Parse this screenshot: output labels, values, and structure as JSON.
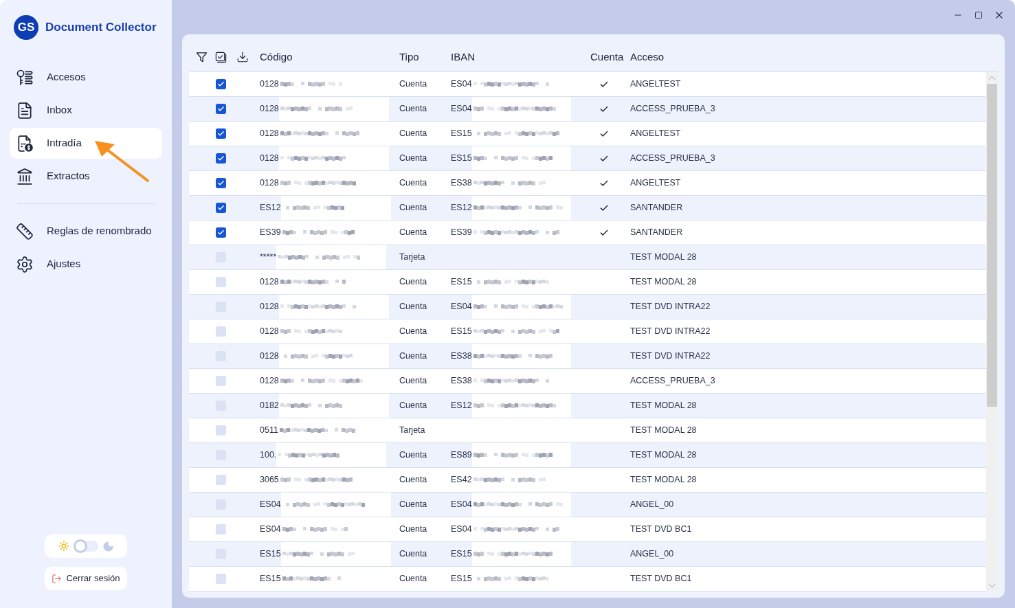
{
  "app": {
    "logo": "GS",
    "title": "Document Collector"
  },
  "nav_sections": [
    {
      "items": [
        {
          "label": "Accesos",
          "selected": false
        },
        {
          "label": "Inbox",
          "selected": false
        },
        {
          "label": "Intradía",
          "selected": true
        },
        {
          "label": "Extractos",
          "selected": false
        }
      ]
    },
    {
      "items": [
        {
          "label": "Reglas de renombrado",
          "selected": false
        },
        {
          "label": "Ajustes",
          "selected": false
        }
      ]
    }
  ],
  "theme_toggle": {
    "on": false
  },
  "logout_button": {
    "label": "Cerrar sesión"
  },
  "table": {
    "columns": [
      "Código",
      "Tipo",
      "IBAN",
      "Cuenta",
      "Acceso"
    ],
    "rows": [
      {
        "checked": true,
        "code": "0128",
        "type": "Cuenta",
        "iban": "ES04",
        "cuenta": true,
        "access": "ANGELTEST"
      },
      {
        "checked": true,
        "code": "0128",
        "type": "Cuenta",
        "iban": "ES04",
        "cuenta": true,
        "access": "ACCESS_PRUEBA_3"
      },
      {
        "checked": true,
        "code": "0128",
        "type": "Cuenta",
        "iban": "ES15",
        "cuenta": true,
        "access": "ANGELTEST"
      },
      {
        "checked": true,
        "code": "0128",
        "type": "Cuenta",
        "iban": "ES15",
        "cuenta": true,
        "access": "ACCESS_PRUEBA_3"
      },
      {
        "checked": true,
        "code": "0128",
        "type": "Cuenta",
        "iban": "ES38",
        "cuenta": true,
        "access": "ANGELTEST"
      },
      {
        "checked": true,
        "code": "ES12",
        "type": "Cuenta",
        "iban": "ES12",
        "cuenta": true,
        "access": "SANTANDER"
      },
      {
        "checked": true,
        "code": "ES39",
        "type": "Cuenta",
        "iban": "ES39",
        "cuenta": true,
        "access": "SANTANDER"
      },
      {
        "checked": false,
        "code": "*****",
        "type": "Tarjeta",
        "cuenta": false,
        "access": "TEST MODAL 28"
      },
      {
        "checked": false,
        "code": "0128",
        "type": "Cuenta",
        "iban": "ES15",
        "cuenta": false,
        "access": "TEST MODAL 28"
      },
      {
        "checked": false,
        "code": "0128",
        "type": "Cuenta",
        "iban": "ES04",
        "cuenta": false,
        "access": "TEST DVD INTRA22"
      },
      {
        "checked": false,
        "code": "0128",
        "type": "Cuenta",
        "iban": "ES15",
        "cuenta": false,
        "access": "TEST DVD INTRA22"
      },
      {
        "checked": false,
        "code": "0128",
        "type": "Cuenta",
        "iban": "ES38",
        "cuenta": false,
        "access": "TEST DVD INTRA22"
      },
      {
        "checked": false,
        "code": "0128",
        "type": "Cuenta",
        "iban": "ES38",
        "cuenta": false,
        "access": "ACCESS_PRUEBA_3"
      },
      {
        "checked": false,
        "code": "0182",
        "type": "Cuenta",
        "iban": "ES12",
        "cuenta": false,
        "access": "TEST MODAL 28"
      },
      {
        "checked": false,
        "code": "0511",
        "type": "Tarjeta",
        "cuenta": false,
        "access": "TEST MODAL 28"
      },
      {
        "checked": false,
        "code": "100.",
        "type": "Cuenta",
        "iban": "ES89",
        "cuenta": false,
        "access": "TEST MODAL 28"
      },
      {
        "checked": false,
        "code": "3065",
        "type": "Cuenta",
        "iban": "ES42",
        "cuenta": false,
        "access": "TEST MODAL 28"
      },
      {
        "checked": false,
        "code": "ES04",
        "type": "Cuenta",
        "iban": "ES04",
        "cuenta": false,
        "access": "ANGEL_00"
      },
      {
        "checked": false,
        "code": "ES04",
        "type": "Cuenta",
        "iban": "ES04",
        "cuenta": false,
        "access": "TEST DVD BC1"
      },
      {
        "checked": false,
        "code": "ES15",
        "type": "Cuenta",
        "iban": "ES15",
        "cuenta": false,
        "access": "ANGEL_00"
      },
      {
        "checked": false,
        "code": "ES15",
        "type": "Cuenta",
        "iban": "ES15",
        "cuenta": false,
        "access": "TEST DVD BC1"
      }
    ]
  }
}
